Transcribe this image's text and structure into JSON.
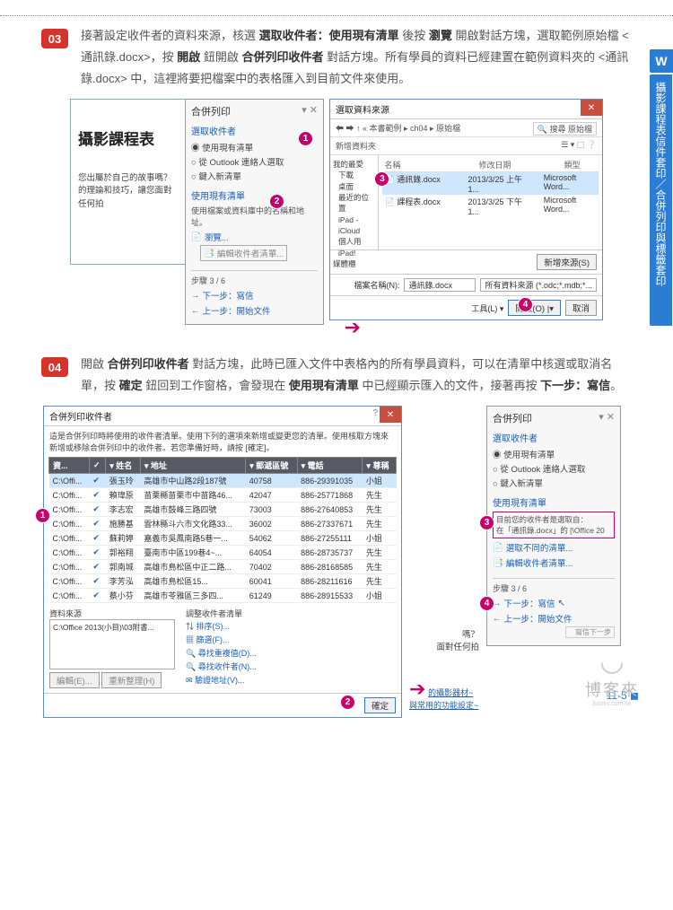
{
  "sidebar": {
    "word_icon": "W",
    "vertical_label": "攝影課程表信件套印／合併列印與標籤套印"
  },
  "step03": {
    "num": "03",
    "text_parts": [
      "接著設定收件者的資料來源，核選 ",
      "選取收件者：使用現有清單",
      " 後按 ",
      "瀏覽",
      " 開啟對話方塊，選取範例原始檔 <通訊錄.docx>，按 ",
      "開啟",
      " 鈕開啟 ",
      "合併列印收件者",
      " 對話方塊。所有學員的資料已經建置在範例資料夾的 <通訊錄.docx> 中，這裡將要把檔案中的表格匯入到目前文件來使用。"
    ]
  },
  "step04": {
    "num": "04",
    "text_parts": [
      "開啟 ",
      "合併列印收件者",
      " 對話方塊，此時已匯入文件中表格內的所有學員資料，可以在清單中核選或取消名單，按 ",
      "確定",
      " 鈕回到工作窗格，會發現在 ",
      "使用現有清單",
      " 中已經顯示匯入的文件，接著再按 ",
      "下一步：寫信",
      "。"
    ]
  },
  "sidepanel": {
    "title": "合併列印",
    "section_select": "選取收件者",
    "opt_existing": "使用現有清單",
    "opt_outlook": "從 Outlook 連絡人選取",
    "opt_new": "鍵入新清單",
    "section_use": "使用現有清單",
    "use_desc": "使用檔案或資料庫中的名稱和地址。",
    "browse": "瀏覽...",
    "edit_recip": "編輯收件者清單...",
    "step_ind": "步驟 3 / 6",
    "next": "下一步：寫信",
    "prev": "上一步：開始文件",
    "current_desc": "目前您的收件者是選取自：",
    "current_file": "在「通訊錄.docx」的 [\\Office 20",
    "alt_select": "選取不同的清單...",
    "alt_edit": "編輯收件者清單..."
  },
  "leftdoc": {
    "heading": "攝影課程表",
    "line1": "您出屬於自己的故事嗎？",
    "line2": "的理論和技巧，讓您面對任何拍"
  },
  "filedlg": {
    "title": "選取資料來源",
    "crumbs": "« 本書範例 ▸ ch04 ▸ 原始檔",
    "search_ph": "搜尋 原始檔",
    "new_folder": "新增資料夾",
    "tree": [
      "我的最愛",
      "下載",
      "桌面",
      "最近的位置",
      "iPad - iCloud",
      "個人用iPad!",
      "媒體櫃"
    ],
    "cols": [
      "名稱",
      "修改日期",
      "類型"
    ],
    "rows": [
      {
        "name": "通訊錄.docx",
        "date": "2013/3/25 上午 1...",
        "type": "Microsoft Word..."
      },
      {
        "name": "課程表.docx",
        "date": "2013/3/25 下午 1...",
        "type": "Microsoft Word..."
      }
    ],
    "fname_lbl": "檔案名稱(N):",
    "fname_val": "通訊錄.docx",
    "filter": "新增來源(S)",
    "type_sel": "所有資料來源 (*.odc;*.mdb;*...",
    "tools": "工具(L)",
    "open": "開啟(O)",
    "cancel": "取消"
  },
  "recipdlg": {
    "title": "合併列印收件者",
    "desc": "這是合併列印時將使用的收件者清單。使用下列的選項來新增或變更您的清單。使用核取方塊來新增或移除合併列印中的收件者。若您準備好時，請按 [確定]。",
    "cols": [
      "資...",
      "✓",
      "姓名",
      "地址",
      "郵遞區號",
      "電話",
      "尊稱"
    ],
    "rows": [
      {
        "src": "C:\\Offi...",
        "name": "張玉玲",
        "addr": "高雄市中山路2段187號",
        "zip": "40758",
        "tel": "886-29391035",
        "title": "小姐"
      },
      {
        "src": "C:\\Offi...",
        "name": "賴瑋原",
        "addr": "苗栗縣苗栗市中苗路46...",
        "zip": "42047",
        "tel": "886-25771868",
        "title": "先生"
      },
      {
        "src": "C:\\Offi...",
        "name": "李志宏",
        "addr": "高雄市鼓峰三路四號",
        "zip": "73003",
        "tel": "886-27640853",
        "title": "先生"
      },
      {
        "src": "C:\\Offi...",
        "name": "施勝基",
        "addr": "雲林縣斗六市文化路33...",
        "zip": "36002",
        "tel": "886-27337671",
        "title": "先生"
      },
      {
        "src": "C:\\Offi...",
        "name": "蘇莉婷",
        "addr": "嘉義市吳鳳南路5巷一...",
        "zip": "54062",
        "tel": "886-27255111",
        "title": "小姐"
      },
      {
        "src": "C:\\Offi...",
        "name": "郭裕翔",
        "addr": "臺南市中區199巷4~...",
        "zip": "64054",
        "tel": "886-28735737",
        "title": "先生"
      },
      {
        "src": "C:\\Offi...",
        "name": "郭南城",
        "addr": "高雄市鳥松區中正二路...",
        "zip": "70402",
        "tel": "886-28168585",
        "title": "先生"
      },
      {
        "src": "C:\\Offi...",
        "name": "李芳泓",
        "addr": "高雄市鳥松區15...",
        "zip": "60041",
        "tel": "886-28211616",
        "title": "先生"
      },
      {
        "src": "C:\\Offi...",
        "name": "蔡小芬",
        "addr": "高雄市苓雅區三多四...",
        "zip": "61249",
        "tel": "886-28915533",
        "title": "小姐"
      }
    ],
    "src_lbl": "資料來源",
    "src_val": "C:\\Office 2013(小目)\\03附書...",
    "refine_lbl": "調整收件者清單",
    "refine_links": [
      "排序(S)...",
      "篩選(F)...",
      "尋找重複值(D)...",
      "尋找收件者(N)...",
      "驗證地址(V)..."
    ],
    "edit_btn": "編輯(E)...",
    "refresh": "重新整理(H)",
    "ok": "確定"
  },
  "doc_under": {
    "q": "嗎？",
    "line": "面對任何拍",
    "links": [
      "的攝影器材~",
      "與常用的功能設定~"
    ]
  },
  "footer": {
    "logo_text": "博客來",
    "url": "books.com.tw",
    "page": "11-5"
  }
}
